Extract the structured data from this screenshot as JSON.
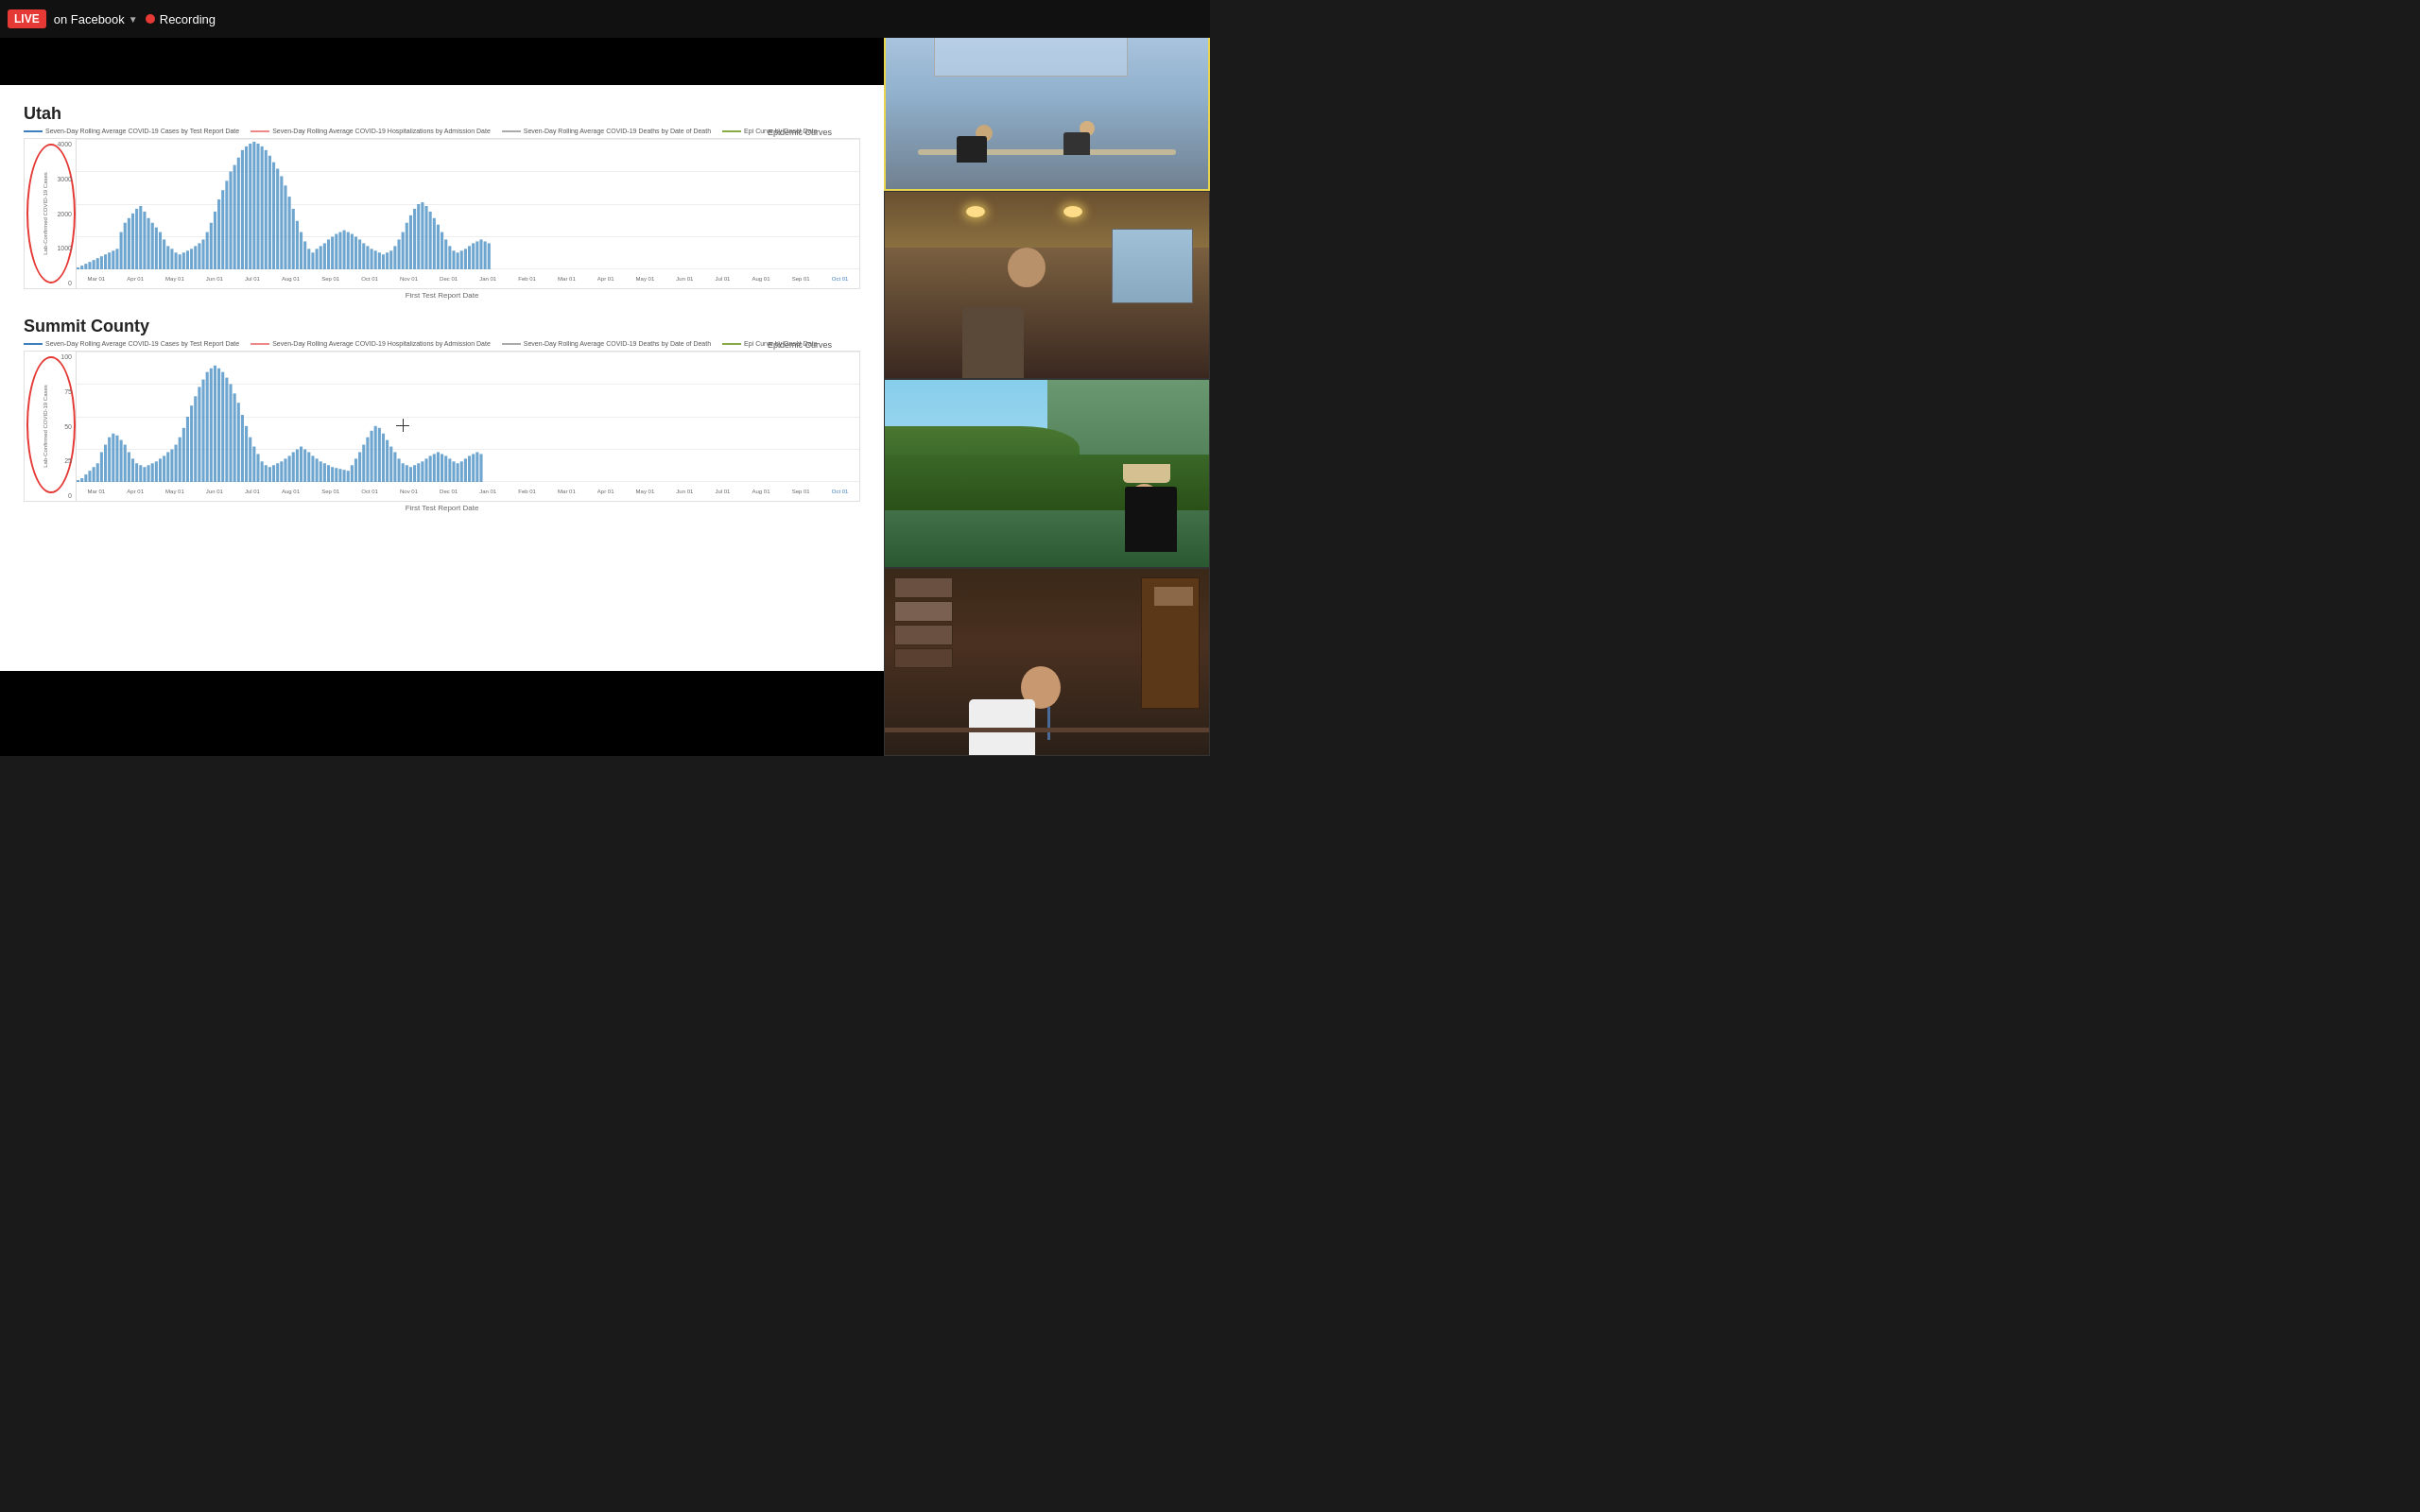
{
  "topbar": {
    "live_label": "LIVE",
    "platform_label": "on Facebook",
    "recording_label": "Recording"
  },
  "presentation": {
    "utah_title": "Utah",
    "summit_title": "Summit County",
    "epidemic_curves_label": "Epidemic Curves",
    "x_axis_label_utah": "First Test Report Date",
    "x_axis_label_summit": "First Test Report Date",
    "utah_legend": [
      "Seven-Day Rolling Average COVID-19 Cases by Test Report Date",
      "Seven-Day Rolling Average COVID-19 Hospitalizations by Admission Date",
      "Seven-Day Rolling Average COVID-19 Deaths by Date of Death",
      "Epi Curve by Onset Date"
    ],
    "summit_legend": [
      "Seven-Day Rolling Average COVID-19 Cases by Test Report Date",
      "Seven-Day Rolling Average COVID-19 Hospitalizations by Admission Date",
      "Seven-Day Rolling Average COVID-19 Deaths by Date of Death",
      "Epi Curve by Onset Date"
    ],
    "utah_y_ticks": [
      "4000",
      "3000",
      "2000",
      "1000",
      "0"
    ],
    "utah_y_label": "Lab-Confirmed COVID-19 Cases",
    "summit_y_ticks": [
      "100",
      "75",
      "50",
      "25",
      "0"
    ],
    "summit_y_label": "Lab-Confirmed COVID-19 Cases",
    "x_ticks": [
      "Mar 01",
      "Apr 01",
      "May 01",
      "Jun 01",
      "Jul 01",
      "Aug 01",
      "Sep 01",
      "Oct 01",
      "Nov 01",
      "Dec 01",
      "Jan 01",
      "Feb 01",
      "Mar 01",
      "Apr 01",
      "May 01",
      "Jun 01",
      "Jul 01",
      "Aug 01",
      "Sep 01",
      "Oct 01"
    ],
    "oct_01_label": "Oct 01"
  },
  "video_panels": [
    {
      "id": "panel-1",
      "active": true,
      "description": "Meeting room with two people at table"
    },
    {
      "id": "panel-2",
      "active": false,
      "description": "Man in wooden cabin interior"
    },
    {
      "id": "panel-3",
      "active": false,
      "description": "Woman with mountain/forest background"
    },
    {
      "id": "panel-4",
      "active": false,
      "description": "Man in office setting"
    }
  ]
}
